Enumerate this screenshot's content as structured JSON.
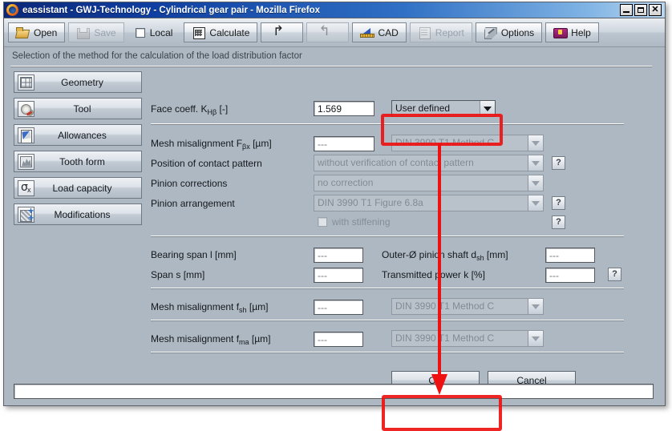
{
  "window": {
    "title": "eassistant - GWJ-Technology - Cylindrical gear pair - Mozilla Firefox",
    "icon": "firefox-icon",
    "minimize_label": "",
    "maximize_label": "",
    "close_label": "✕"
  },
  "toolbar": {
    "open_label": "Open",
    "save_label": "Save",
    "local_label": "Local",
    "calculate_label": "Calculate",
    "undo_label": "",
    "redo_label": "",
    "cad_label": "CAD",
    "report_label": "Report",
    "options_label": "Options",
    "help_label": "Help"
  },
  "section": {
    "title": "Selection of the method for the calculation of the load distribution factor"
  },
  "sidebar": {
    "items": [
      {
        "label": "Geometry",
        "icon": "grid-icon"
      },
      {
        "label": "Tool",
        "icon": "gear-cutter-icon"
      },
      {
        "label": "Allowances",
        "icon": "chart-sheet-icon"
      },
      {
        "label": "Tooth form",
        "icon": "tooth-profile-icon"
      },
      {
        "label": "Load capacity",
        "icon": "sigma-x-icon"
      },
      {
        "label": "Modifications",
        "icon": "hatched-plus-icon"
      }
    ]
  },
  "form": {
    "face_coeff": {
      "label_main": "Face coeff. K",
      "label_sub": "Hβ",
      "label_unit": "[-]",
      "value": "1.569",
      "method": "User defined"
    },
    "mesh_misalignment_fbx": {
      "label_main": "Mesh misalignment F",
      "label_sub": "βx",
      "label_unit": "[µm]",
      "value": "---",
      "method": "DIN 3990 T1 Method C"
    },
    "position_contact_pattern": {
      "label": "Position of contact pattern",
      "value": "without verification of contact pattern"
    },
    "pinion_corrections": {
      "label": "Pinion corrections",
      "value": "no correction"
    },
    "pinion_arrangement": {
      "label": "Pinion arrangement",
      "value": "DIN 3990 T1 Figure 6.8a"
    },
    "with_stiffening": {
      "label": "with stiffening",
      "checked": false
    },
    "bearing_span": {
      "label": "Bearing span l [mm]",
      "value": "---"
    },
    "span_s": {
      "label": "Span s [mm]",
      "value": "---"
    },
    "outer_diameter_pinion_shaft": {
      "label_main": "Outer-Ø pinion shaft d",
      "label_sub": "sh",
      "label_unit": "[mm]",
      "value": "---"
    },
    "transmitted_power": {
      "label": "Transmitted power k [%]",
      "value": "---"
    },
    "mesh_misalignment_fsh": {
      "label_main": "Mesh misalignment f",
      "label_sub": "sh",
      "label_unit": "[µm]",
      "value": "---",
      "method": "DIN 3990 T1 Method C"
    },
    "mesh_misalignment_fma": {
      "label_main": "Mesh misalignment f",
      "label_sub": "ma",
      "label_unit": "[µm]",
      "value": "---",
      "method": "DIN 3990 T1 Method C"
    },
    "help_marker": "?"
  },
  "dialog": {
    "ok_label": "OK",
    "cancel_label": "Cancel"
  },
  "status": {
    "text": ""
  },
  "annotations": {
    "color": "#ee1111",
    "highlight_combo": "User defined dropdown highlighted",
    "highlight_ok": "OK button highlighted",
    "arrow": "arrow from dropdown down to OK button"
  }
}
